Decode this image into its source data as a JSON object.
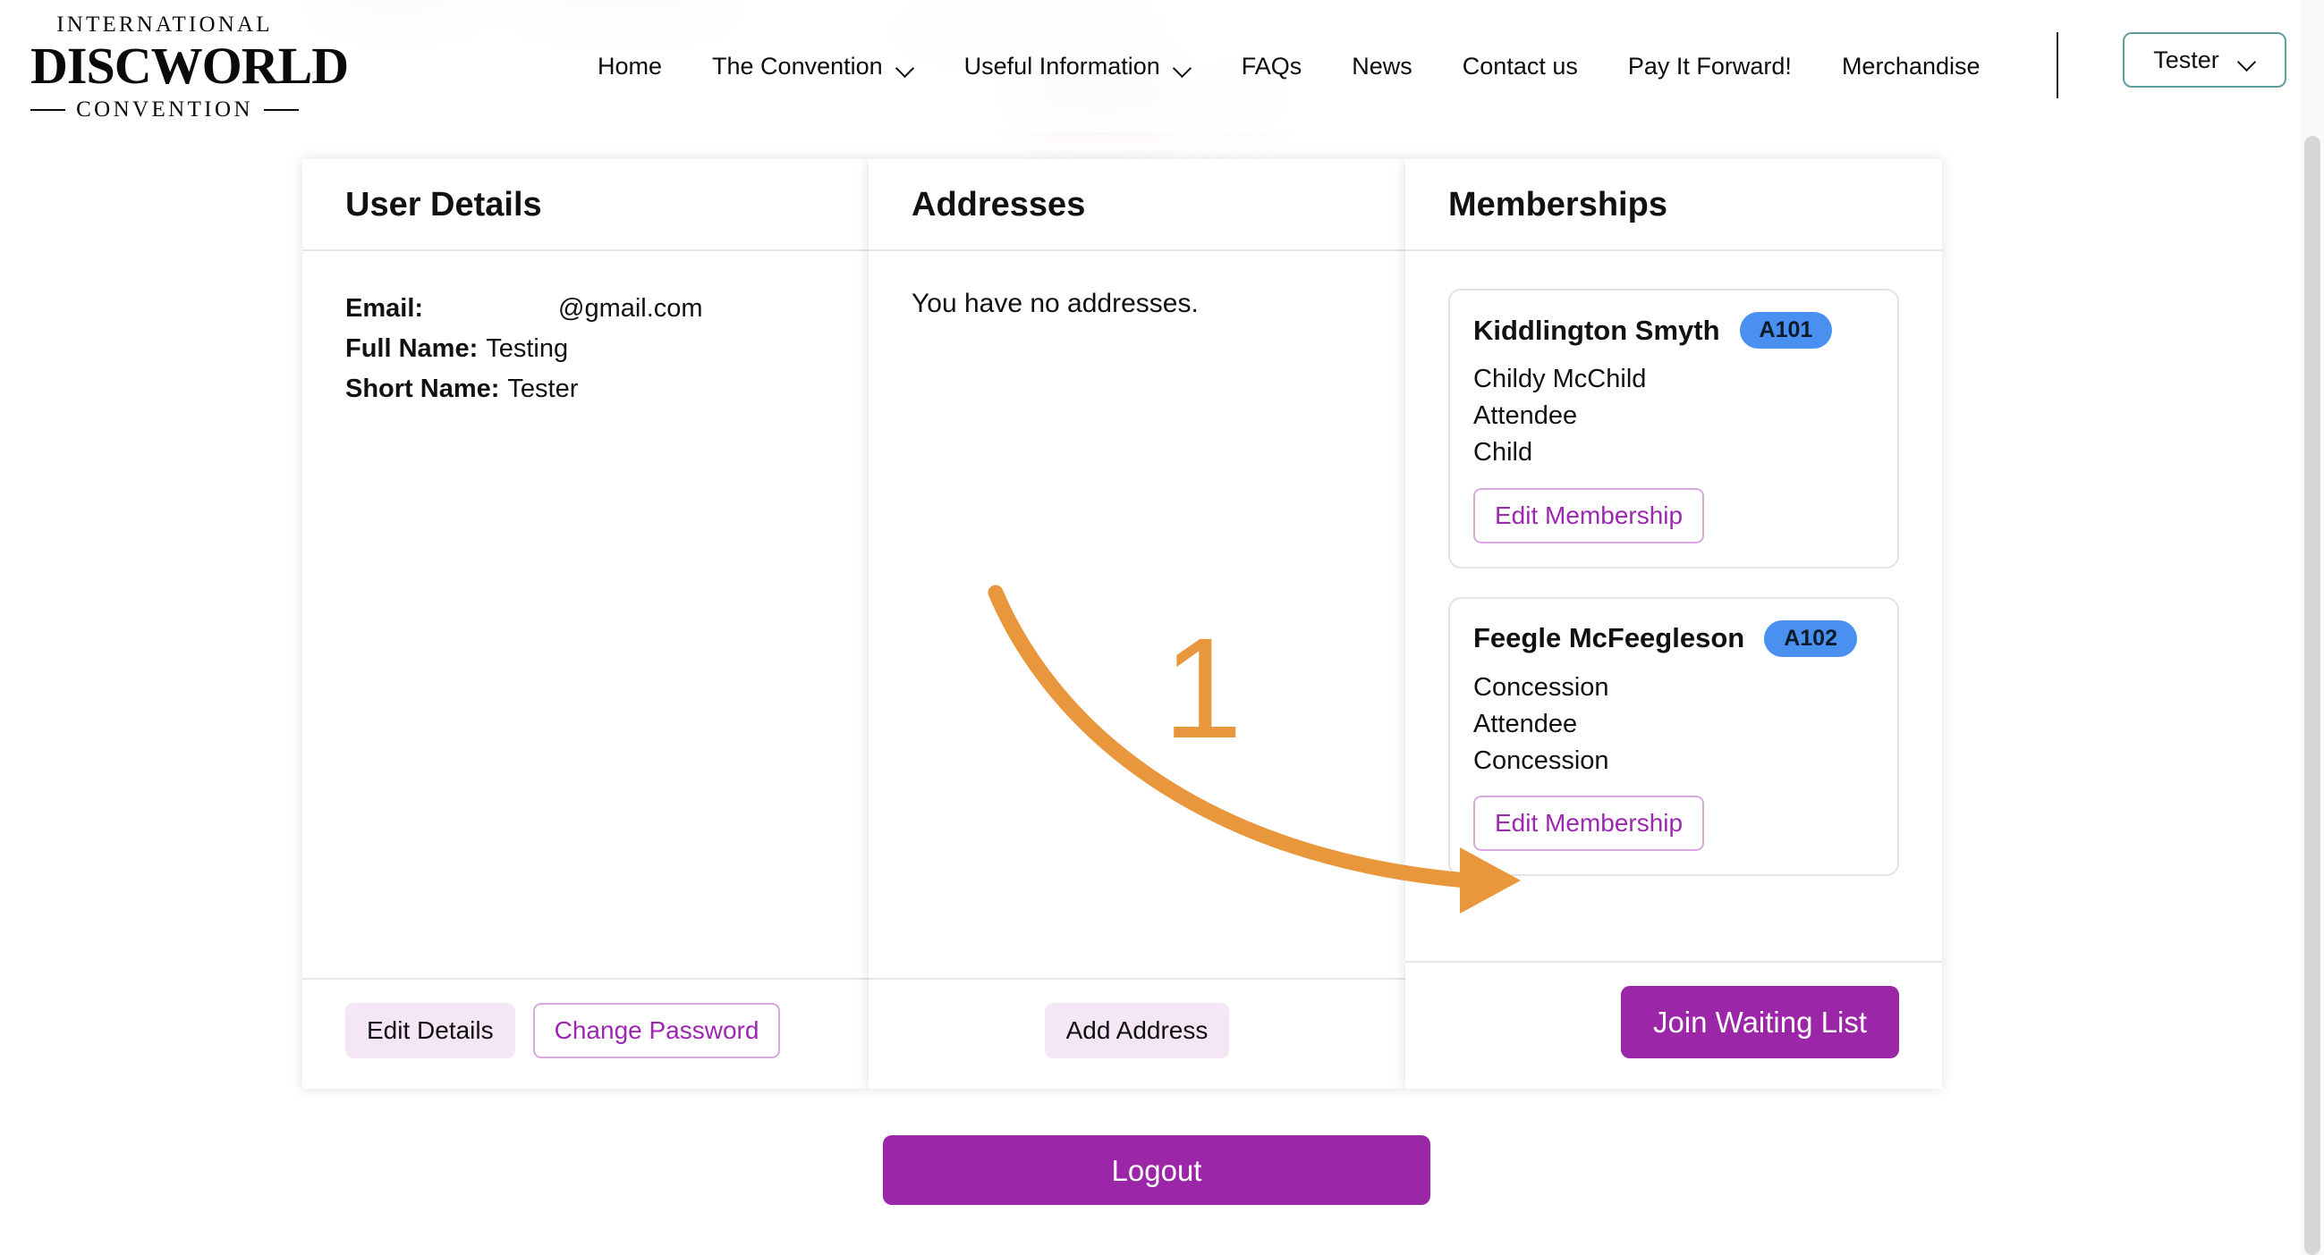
{
  "header": {
    "logo": {
      "line1": "INTERNATIONAL",
      "line2": "DISCWORLD",
      "line3": "CONVENTION"
    },
    "nav_items": [
      {
        "label": "Home",
        "has_dropdown": false
      },
      {
        "label": "The Convention",
        "has_dropdown": true
      },
      {
        "label": "Useful Information",
        "has_dropdown": true
      },
      {
        "label": "FAQs",
        "has_dropdown": false
      },
      {
        "label": "News",
        "has_dropdown": false
      },
      {
        "label": "Contact us",
        "has_dropdown": false
      },
      {
        "label": "Pay It Forward!",
        "has_dropdown": false
      },
      {
        "label": "Merchandise",
        "has_dropdown": false
      }
    ],
    "user_menu": {
      "label": "Tester",
      "chevron_icon": "chevron-down-icon"
    }
  },
  "user_details": {
    "title": "User Details",
    "email_label": "Email:",
    "email_value": "@gmail.com",
    "full_name_label": "Full Name:",
    "full_name_value": "Testing",
    "short_name_label": "Short Name:",
    "short_name_value": "Tester",
    "edit_details_label": "Edit Details",
    "change_password_label": "Change Password"
  },
  "addresses": {
    "title": "Addresses",
    "empty_message": "You have no addresses.",
    "add_address_label": "Add Address"
  },
  "memberships": {
    "title": "Memberships",
    "items": [
      {
        "name": "Kiddlington Smyth",
        "badge": "A101",
        "line1": "Childy McChild",
        "line2": "Attendee",
        "line3": "Child",
        "edit_label": "Edit Membership"
      },
      {
        "name": "Feegle McFeegleson",
        "badge": "A102",
        "line1": "Concession",
        "line2": "Attendee",
        "line3": "Concession",
        "edit_label": "Edit Membership"
      }
    ],
    "join_waiting_list_label": "Join Waiting List"
  },
  "logout_label": "Logout",
  "annotation": {
    "step_number": "1",
    "arrow_color": "#e8973c",
    "points_to": "Edit Membership"
  },
  "colors": {
    "brand_purple": "#9b26a8",
    "soft_purple_bg": "#f5e6f5",
    "outline_purple": "#d9a8dd",
    "purple_text": "#9c27b0",
    "badge_blue": "#4a90f0",
    "annotation_orange": "#e8973c",
    "user_menu_border": "#5f9ea0"
  }
}
